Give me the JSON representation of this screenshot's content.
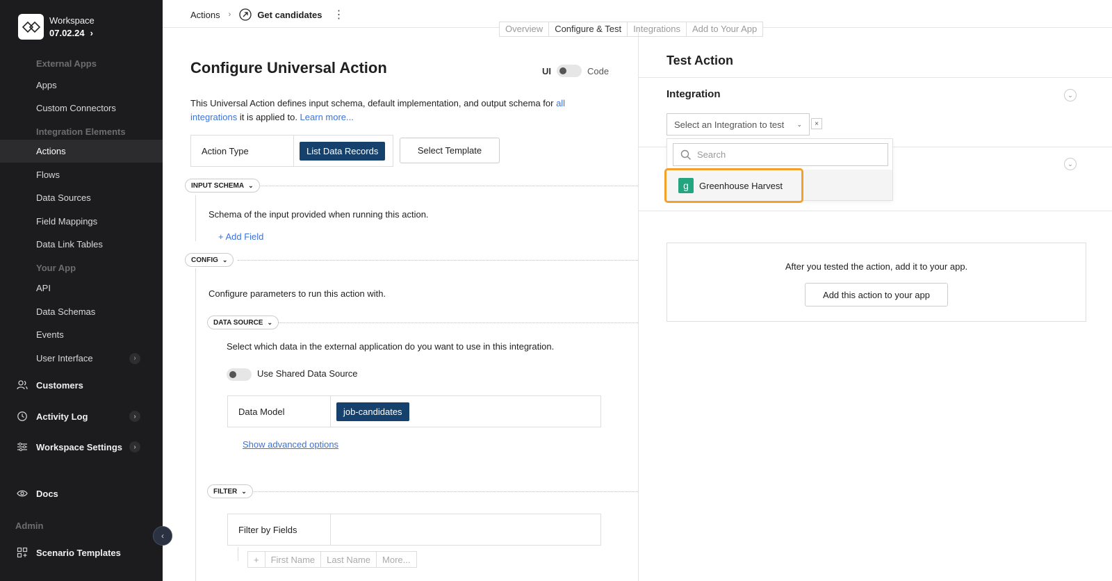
{
  "workspace": {
    "name": "Workspace",
    "version": "07.02.24",
    "chevron": "›"
  },
  "sidebar": {
    "sections": [
      "External Apps",
      "Integration Elements",
      "Your App",
      "Admin"
    ],
    "items": [
      {
        "label": "Apps"
      },
      {
        "label": "Custom Connectors"
      },
      {
        "label": "Actions",
        "active": true
      },
      {
        "label": "Flows"
      },
      {
        "label": "Data Sources"
      },
      {
        "label": "Field Mappings"
      },
      {
        "label": "Data Link Tables"
      },
      {
        "label": "API"
      },
      {
        "label": "Data Schemas"
      },
      {
        "label": "Events"
      },
      {
        "label": "User Interface"
      }
    ],
    "main": [
      {
        "label": "Customers"
      },
      {
        "label": "Activity Log"
      },
      {
        "label": "Workspace Settings"
      },
      {
        "label": "Docs"
      },
      {
        "label": "Scenario Templates"
      }
    ],
    "chev": "›",
    "collapse": "‹"
  },
  "breadcrumb": {
    "root": "Actions",
    "sep": "›",
    "current": "Get candidates",
    "menu": "⋮"
  },
  "tabs": [
    "Overview",
    "Configure & Test",
    "Integrations",
    "Add to Your App"
  ],
  "main": {
    "title": "Configure Universal Action",
    "toggle": {
      "left": "UI",
      "right": "Code"
    },
    "desc_1": "This Universal Action defines input schema, default implementation, and output schema for ",
    "desc_link1": "all integrations",
    "desc_2": " it is applied to. ",
    "desc_link2": "Learn more...",
    "action_type_label": "Action Type",
    "action_type_value": "List Data Records",
    "select_template": "Select Template",
    "input_schema": "INPUT SCHEMA",
    "input_schema_desc": "Schema of the input provided when running this action.",
    "add_field": "+ Add Field",
    "config": "CONFIG",
    "config_desc": "Configure parameters to run this action with.",
    "data_source": "DATA SOURCE",
    "data_source_desc": "Select which data in the external application do you want to use in this integration.",
    "shared_ds": "Use Shared Data Source",
    "data_model_label": "Data Model",
    "data_model_value": "job-candidates",
    "show_advanced": "Show advanced options",
    "filter": "FILTER",
    "filter_label": "Filter by Fields",
    "chips": [
      "+",
      "First Name",
      "Last Name",
      "More..."
    ],
    "chev": "⌄"
  },
  "right": {
    "title": "Test Action",
    "integration": "Integration",
    "select_placeholder": "Select an Integration to test",
    "clear": "×",
    "search_placeholder": "Search",
    "option": "Greenhouse Harvest",
    "card_text": "After you tested the action, add it to your app.",
    "card_button": "Add this action to your app",
    "chev": "⌄"
  },
  "colors": {
    "sidebar": "#1c1c1e",
    "accent": "#15416c",
    "link": "#3b72d9",
    "highlight": "#f2a22c",
    "greenhouse": "#24a47f"
  }
}
